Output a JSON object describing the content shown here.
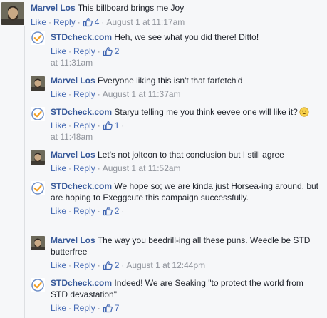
{
  "comments": [
    {
      "author": "Marvel Los",
      "text": "This billboard brings me Joy",
      "like": "Like",
      "reply": "Reply",
      "likes": "4",
      "time": "August 1 at 11:17am"
    },
    {
      "author": "STDcheck.com",
      "text": "Heh, we see what you did there! Ditto!",
      "like": "Like",
      "reply": "Reply",
      "likes": "2",
      "time": "at 11:31am"
    },
    {
      "author": "Marvel Los",
      "text": "Everyone liking this isn't that farfetch'd",
      "like": "Like",
      "reply": "Reply",
      "time": "August 1 at 11:37am"
    },
    {
      "author": "STDcheck.com",
      "text": "Staryu telling me you think eevee one will like it?",
      "like": "Like",
      "reply": "Reply",
      "likes": "1",
      "time": "at 11:48am"
    },
    {
      "author": "Marvel Los",
      "text": "Let's not jolteon to that conclusion but I still agree",
      "like": "Like",
      "reply": "Reply",
      "time": "August 1 at 11:52am"
    },
    {
      "author": "STDcheck.com",
      "text": "We hope so; we are kinda just Horsea-ing around, but are hoping to Exeggcute this campaign successfully.",
      "like": "Like",
      "reply": "Reply",
      "likes": "2"
    },
    {
      "author": "Marvel Los",
      "text": "The way you beedrill-ing all these puns. Weedle be STD butterfree",
      "like": "Like",
      "reply": "Reply",
      "likes": "2",
      "time": "August 1 at 12:44pm"
    },
    {
      "author": "STDcheck.com",
      "text": "Indeed! We are Seaking \"to protect the world from STD devastation\"",
      "like": "Like",
      "reply": "Reply",
      "likes": "7"
    }
  ]
}
